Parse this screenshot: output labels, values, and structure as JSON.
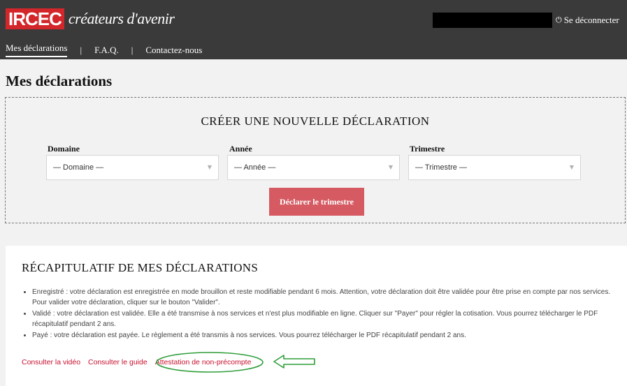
{
  "header": {
    "logo_text": "IRCEC",
    "logo_tagline": "créateurs d'avenir",
    "logout_label": "Se déconnecter",
    "nav": [
      {
        "label": "Mes déclarations"
      },
      {
        "label": "F.A.Q."
      },
      {
        "label": "Contactez-nous"
      }
    ],
    "nav_separator": "|"
  },
  "page": {
    "title": "Mes déclarations"
  },
  "create": {
    "title": "CRÉER UNE NOUVELLE DÉCLARATION",
    "fields": [
      {
        "label": "Domaine",
        "value": "— Domaine —"
      },
      {
        "label": "Année",
        "value": "— Année —"
      },
      {
        "label": "Trimestre",
        "value": "— Trimestre —"
      }
    ],
    "submit_label": "Déclarer le trimestre"
  },
  "recap": {
    "title": "RÉCAPITULATIF DE MES DÉCLARATIONS",
    "items": [
      "Enregistré : votre déclaration est enregistrée en mode brouillon et reste modifiable pendant 6 mois. Attention, votre déclaration doit être validée pour être prise en compte par nos services. Pour valider votre déclaration, cliquer sur le bouton \"Valider\".",
      "Validé : votre déclaration est validée. Elle a été transmise à nos services et n'est plus modifiable en ligne. Cliquer sur \"Payer\" pour régler la cotisation. Vous pourrez télécharger le PDF récapitulatif pendant 2 ans.",
      "Payé : votre déclaration est payée. Le règlement a été transmis à nos services. Vous pourrez télécharger le PDF récapitulatif pendant 2 ans."
    ],
    "links": [
      {
        "label": "Consulter la vidéo"
      },
      {
        "label": "Consulter le guide"
      },
      {
        "label": "Attestation de non-précompte"
      }
    ]
  },
  "colors": {
    "header_bg": "#3a3a3a",
    "brand_red": "#d3262a",
    "button_bg": "#d55a62",
    "link_red": "#c8102e",
    "annotation_green": "#2e9e3a"
  },
  "icons": {
    "logout": "power-icon",
    "select_arrow": "caret-down-icon"
  }
}
